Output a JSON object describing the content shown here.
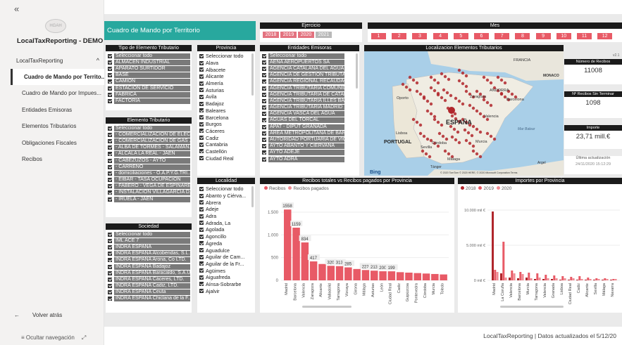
{
  "app": {
    "name": "LocalTaxReporting - DEMO",
    "logo_text": "HGAH"
  },
  "nav": {
    "section": "LocalTaxReporting",
    "items": [
      "Cuadro de Mando por Territo...",
      "Cuadro de Mando por Impues...",
      "Entidades Emisoras",
      "Elementos Tributarios",
      "Obligaciones Fiscales",
      "Recibos"
    ],
    "back": "Volver atrás",
    "hide": "Ocultar navegación"
  },
  "status": "LocalTaxReporting  |  Datos actualizados el 5/12/20",
  "title": "Cuadro de Mando por Territorio",
  "filters": {
    "tipo": {
      "title": "Tipo de Elemento Tributario",
      "items": [
        "Seleccionar todo",
        "ALMACEN INDUSTRIAL",
        "APARATO SURTIDOR",
        "BASE",
        "CAMION",
        "ESTACION DE SERVICIO",
        "FABRICA",
        "FACTORIA"
      ]
    },
    "provincia": {
      "title": "Provincia",
      "items": [
        "Seleccionar todo",
        "Alava",
        "Albacete",
        "Alicante",
        "Almería",
        "Asturias",
        "Avila",
        "Badajoz",
        "Baleares",
        "Barcelona",
        "Burgos",
        "Cáceres",
        "Cadiz",
        "Cantabria",
        "Castellón",
        "Ciudad Real"
      ]
    },
    "elemento": {
      "title": "Elemento Tributario",
      "items": [
        "Seleccionar todo",
        "- COMERCIALIZACION DE ELEC...",
        "- COMERCIALIZACION DE GAS ...",
        "- ALBA DE TORMES - SALAMAN...",
        "- ALCALA LA REAL - JAEN",
        "- CABEZUZOS - AYTO",
        "- CARREÑO",
        "- domiciliaciones - O.A.P.Y.G.TRI...",
        "- EIBAR - TASA OCUPACIÓN",
        "- FABERO - VEGA DE ESPINARED...",
        "- INSTALACION VILLAGARCIA D...",
        "- IRUELA - JAEN"
      ]
    },
    "sociedad": {
      "title": "Sociedad",
      "items": [
        "Seleccionar todo",
        "IML ACE 7",
        "INDRA ESPAÑA",
        "INDRA ESPAÑA Alcobendas, S.L.",
        "INDRA ESPAÑA Arona, Co LTD.",
        "INDRA ESPAÑA Badajoz",
        "INDRA ESPAÑA Baracaldo, S.A.U.",
        "INDRA ESPAÑA Cáceres, LTD.",
        "INDRA ESPAÑA Cadiz, LTD.",
        "INDRA ESPAÑA Ceuta",
        "INDRA ESPAÑA Chiclana de la F..."
      ]
    },
    "localidad": {
      "title": "Localidad",
      "items": [
        "Seleccionar todo",
        "Abanto y Ciérva...",
        "Abrera",
        "Adeje",
        "Adra",
        "Adrada, La",
        "Agolada",
        "Agoncillo",
        "Ágreda",
        "Aguadulce",
        "Aguilar de Cam...",
        "Aguilar de la Fr...",
        "Agüimes",
        "Aiguafreda",
        "Aínsa-Sobrarbe",
        "Ajalvir"
      ]
    },
    "entidades": {
      "title": "Entidades Emisoras",
      "items": [
        "Seleccionar todo",
        "AENA AEROPUERTOS SA",
        "AGENCIA CATALANA DEL AGUA",
        "AGENCIA DE GESTION TRIBUTARIA Y ...",
        "AGENCIA REGIONAL RECAUDACION ...",
        "AGENCIA TRIBUTARIA COMUNIDAD ...",
        "AGENCIA TRIBUTARIA DE CATALUÑA",
        "AGENCIA TRIBUTARIA ILLES BALEARS",
        "AGENCIA TRIBUTARIA MADRID",
        "AGENCIA VASCA DEL AGUA",
        "AGUAS DEL TORCAL",
        "APAT - DIPUT GRANADA",
        "AREA METROPOLITANA DE BARCELO...",
        "AUTORIDAD PORTUARIA DE VIGO",
        "AYTO ABANTO Y CIERVANA",
        "AYTO ADEJE",
        "AYTO ADRA"
      ]
    }
  },
  "ejercicio": {
    "title": "Ejercicio",
    "years": [
      "2018",
      "2019",
      "2020",
      "2021"
    ]
  },
  "mes": {
    "title": "Mes",
    "months": [
      "1",
      "2",
      "3",
      "4",
      "5",
      "6",
      "7",
      "8",
      "9",
      "10",
      "11",
      "12"
    ]
  },
  "map": {
    "title": "Localizacion Elementos Tributarios",
    "labels": [
      "FRANCIA",
      "MONACO",
      "ANDORRA",
      "ESPAÑA",
      "PORTUGAL",
      "Lisboa",
      "Sevilla",
      "Málaga",
      "Murcia",
      "Zaragoza",
      "Barcelona",
      "Valencia",
      "Córdoba",
      "Oporto",
      "Tánger",
      "Argel",
      "Mar Balear"
    ],
    "bing": "Bing",
    "credit": "© 2020 TomTom © 2020 HERE, © 2020 Microsoft Corporation  Terms"
  },
  "kpis": {
    "version": "v2.1",
    "recibos_label": "Número de Recibos",
    "recibos": "11008",
    "sin_label": "Nº Recibos Sin Terminar",
    "sin": "1098",
    "importe_label": "Importe",
    "importe": "23,71 mill.€",
    "upd_label": "Última actualización",
    "upd": "24/11/2020 15:12:29"
  },
  "colors": {
    "teal": "#28a89e",
    "red": "#e85a66",
    "pink": "#f08c94",
    "dark": "#b0262c"
  },
  "chart_data": [
    {
      "type": "bar",
      "title": "Recibos totales vs Recibos pagados por Provincia",
      "series": [
        {
          "name": "Recibos",
          "values": [
            1558,
            1159,
            834,
            417,
            null,
            320,
            313,
            285,
            null,
            227,
            213,
            200,
            199,
            null,
            null,
            null,
            null
          ]
        },
        {
          "name": "Recibos pagados",
          "values": [
            null,
            null,
            null,
            null,
            null,
            null,
            null,
            null,
            null,
            null,
            null,
            null,
            null,
            null,
            null,
            null,
            null
          ]
        }
      ],
      "categories": [
        "Madrid",
        "Barcelona",
        "Valencia",
        "Zaragoza",
        "Alicante",
        "Valladolid",
        "Tarragona",
        "Vizcaya",
        "Girona",
        "Málaga",
        "Asturias",
        "León",
        "Ciudad Real",
        "Cadiz",
        "Guipúzcoa",
        "Pontevedra",
        "Córdoba",
        "Murcia",
        "Toledo"
      ],
      "yticks": [
        "0",
        "500",
        "1.000",
        "1.500"
      ],
      "ylim": [
        0,
        1700
      ]
    },
    {
      "type": "bar",
      "title": "Importes por Provincia",
      "series": [
        {
          "name": "2018"
        },
        {
          "name": "2019"
        },
        {
          "name": "2020"
        }
      ],
      "categories": [
        "Madrid",
        "La Coruña",
        "Valencia",
        "Barcelona",
        "Murcia",
        "Tarragona",
        "Valencia",
        "Granada",
        "Lisboa",
        "Ciudad Real",
        "Cadiz",
        "Alicante",
        "Sevilla",
        "Málaga",
        "Navarra"
      ],
      "yticks": [
        "0 mil €",
        "5.000 mil €",
        "10.000 mil €"
      ]
    }
  ]
}
